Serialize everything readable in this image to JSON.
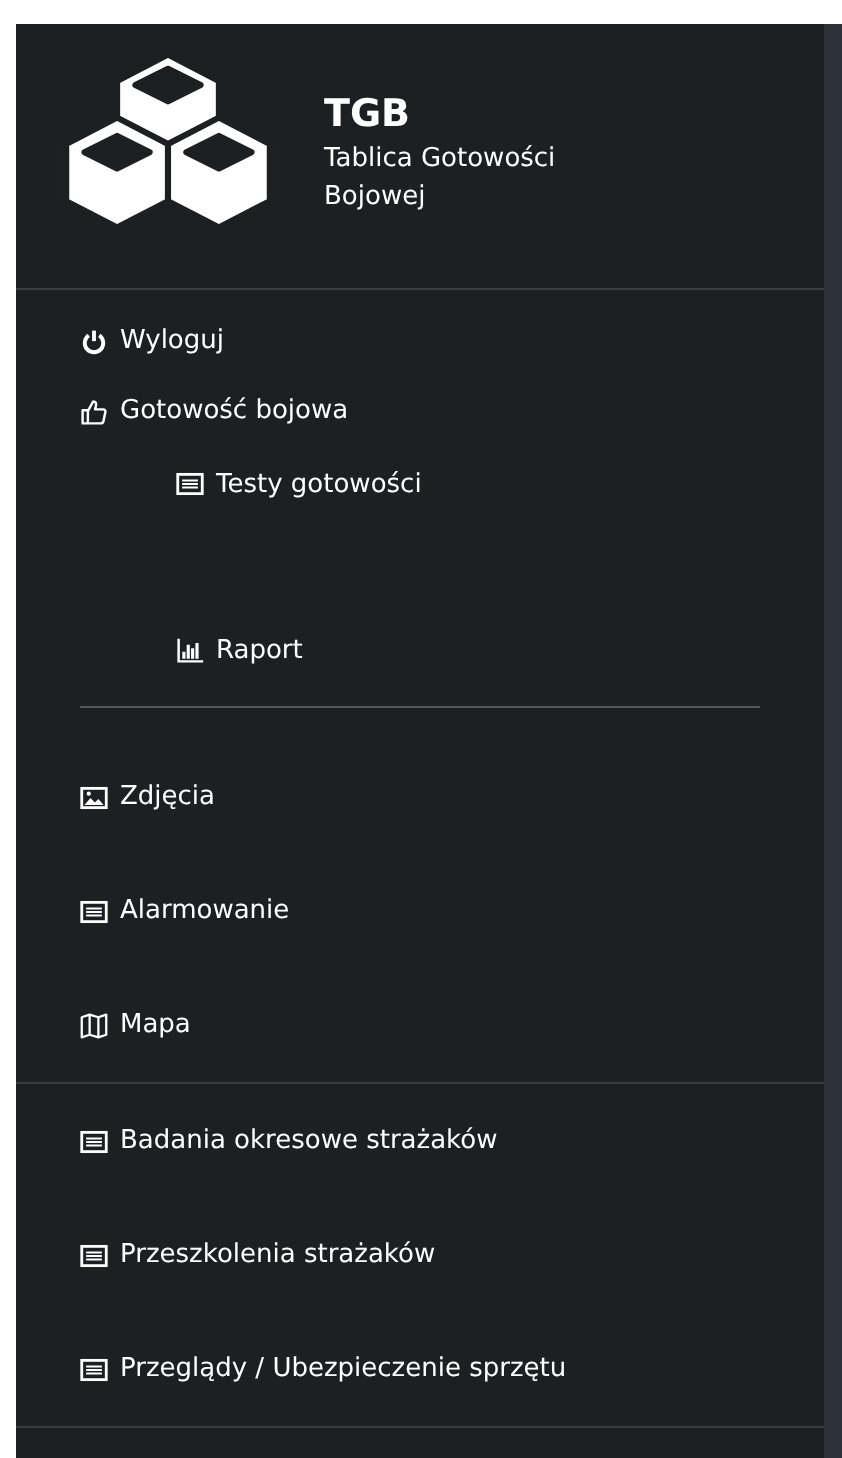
{
  "header": {
    "title": "TGB",
    "subtitle": "Tablica Gotowości Bojowej"
  },
  "groups": [
    {
      "items": [
        {
          "label": "Wyloguj",
          "kind": "power"
        },
        {
          "label": "Gotowość bojowa",
          "kind": "thumbs-up",
          "children": [
            {
              "label": "Testy gotowości",
              "kind": "list"
            },
            {
              "label": "Raport",
              "kind": "chart"
            }
          ]
        }
      ]
    },
    {
      "items": [
        {
          "label": "Zdjęcia",
          "kind": "image"
        },
        {
          "label": "Alarmowanie",
          "kind": "list"
        },
        {
          "label": "Mapa",
          "kind": "map"
        }
      ]
    },
    {
      "items": [
        {
          "label": "Badania okresowe strażaków",
          "kind": "list"
        },
        {
          "label": "Przeszkolenia strażaków",
          "kind": "list"
        },
        {
          "label": "Przeglądy / Ubezpieczenie sprzętu",
          "kind": "list"
        }
      ]
    }
  ]
}
